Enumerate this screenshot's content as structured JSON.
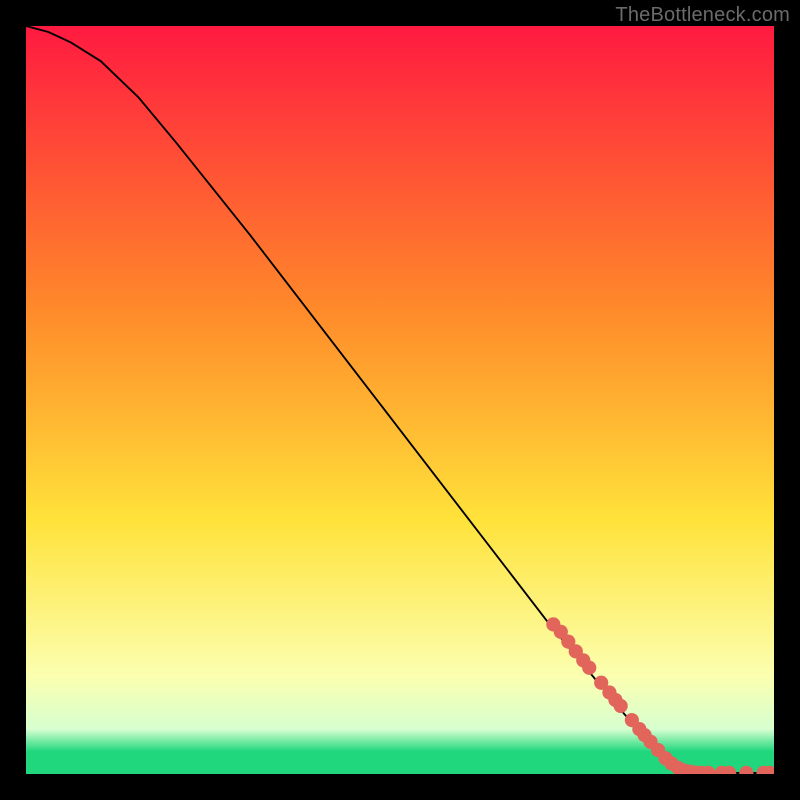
{
  "watermark": "TheBottleneck.com",
  "colors": {
    "marker": "#e2655c",
    "curve": "#000000",
    "grad_top": "#ff1a40",
    "grad_mid1": "#ff8a2a",
    "grad_mid2": "#ffe23a",
    "grad_mid3": "#fbffb0",
    "grad_bottom_pale": "#d7ffcf",
    "grad_green": "#20d77d"
  },
  "chart_data": {
    "type": "line",
    "title": "",
    "xlabel": "",
    "ylabel": "",
    "xlim": [
      0,
      100
    ],
    "ylim": [
      0,
      100
    ],
    "curve": [
      {
        "x": 0,
        "y": 100
      },
      {
        "x": 3,
        "y": 99.2
      },
      {
        "x": 6,
        "y": 97.8
      },
      {
        "x": 10,
        "y": 95.3
      },
      {
        "x": 15,
        "y": 90.5
      },
      {
        "x": 20,
        "y": 84.5
      },
      {
        "x": 30,
        "y": 72.0
      },
      {
        "x": 40,
        "y": 59.0
      },
      {
        "x": 50,
        "y": 46.0
      },
      {
        "x": 60,
        "y": 33.0
      },
      {
        "x": 70,
        "y": 20.0
      },
      {
        "x": 80,
        "y": 8.0
      },
      {
        "x": 85,
        "y": 2.5
      },
      {
        "x": 87,
        "y": 1.0
      },
      {
        "x": 88.5,
        "y": 0.4
      },
      {
        "x": 90,
        "y": 0.15
      },
      {
        "x": 100,
        "y": 0.15
      }
    ],
    "markers": [
      {
        "x": 70.5,
        "y": 20.0
      },
      {
        "x": 71.5,
        "y": 19.0
      },
      {
        "x": 72.5,
        "y": 17.7
      },
      {
        "x": 73.5,
        "y": 16.4
      },
      {
        "x": 74.5,
        "y": 15.2
      },
      {
        "x": 75.3,
        "y": 14.2
      },
      {
        "x": 76.9,
        "y": 12.2
      },
      {
        "x": 78.0,
        "y": 10.9
      },
      {
        "x": 78.8,
        "y": 9.9
      },
      {
        "x": 79.5,
        "y": 9.1
      },
      {
        "x": 81.0,
        "y": 7.2
      },
      {
        "x": 82.0,
        "y": 6.0
      },
      {
        "x": 82.7,
        "y": 5.2
      },
      {
        "x": 83.5,
        "y": 4.3
      },
      {
        "x": 84.5,
        "y": 3.2
      },
      {
        "x": 85.5,
        "y": 2.1
      },
      {
        "x": 86.3,
        "y": 1.4
      },
      {
        "x": 87.2,
        "y": 0.8
      },
      {
        "x": 88.0,
        "y": 0.45
      },
      {
        "x": 88.8,
        "y": 0.3
      },
      {
        "x": 89.5,
        "y": 0.18
      },
      {
        "x": 90.3,
        "y": 0.15
      },
      {
        "x": 91.2,
        "y": 0.15
      },
      {
        "x": 93.0,
        "y": 0.15
      },
      {
        "x": 94.0,
        "y": 0.15
      },
      {
        "x": 96.3,
        "y": 0.15
      },
      {
        "x": 98.6,
        "y": 0.15
      },
      {
        "x": 99.4,
        "y": 0.15
      }
    ]
  }
}
